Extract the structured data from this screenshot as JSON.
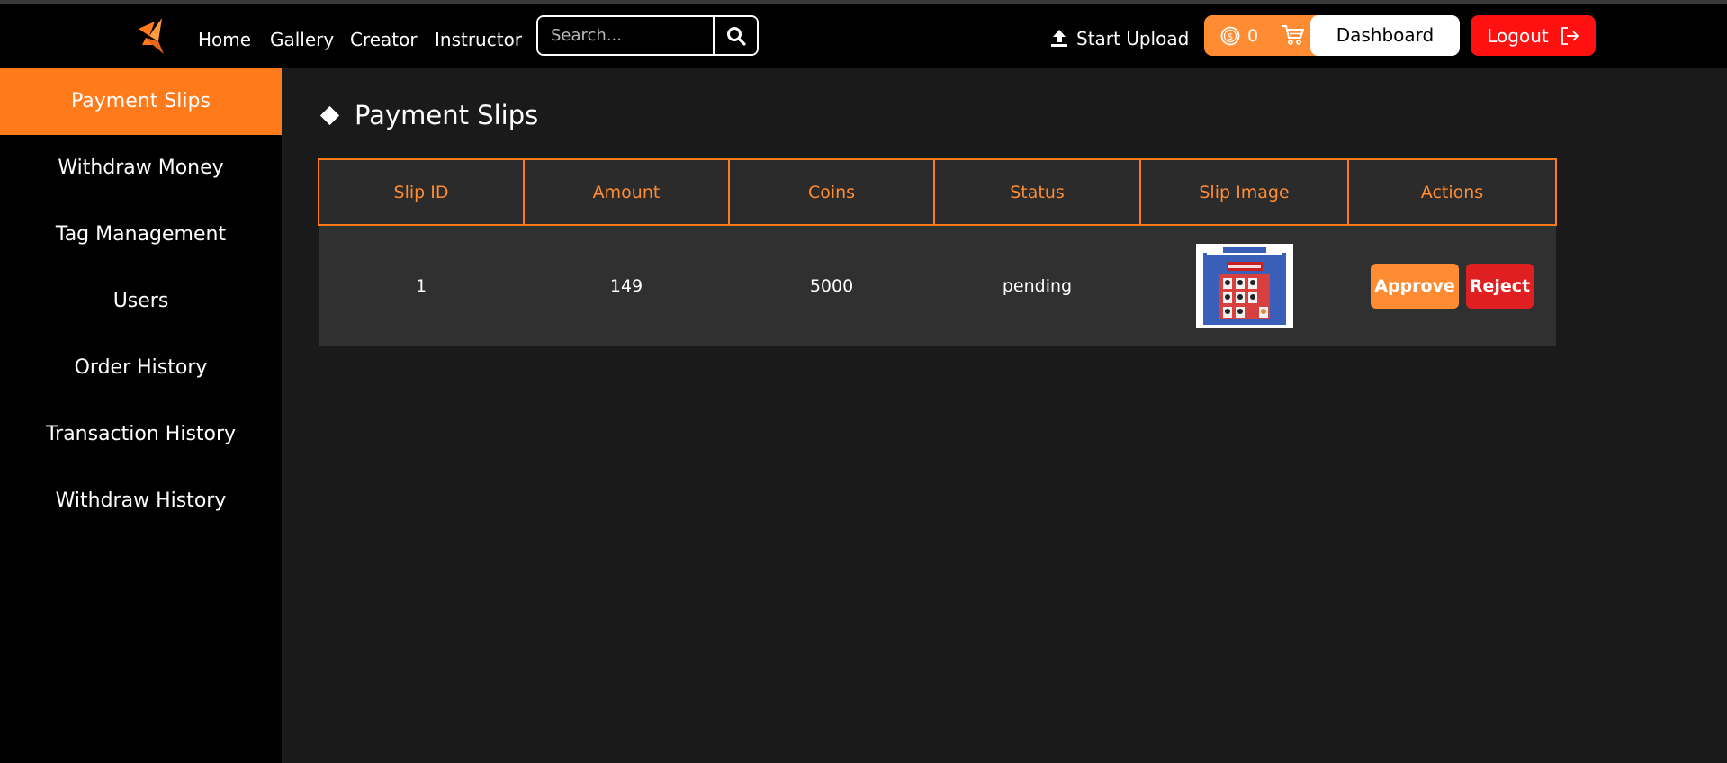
{
  "nav": {
    "logo_icon": "origami-bird-logo-icon",
    "links": [
      "Home",
      "Gallery",
      "Creator",
      "Instructor"
    ],
    "search_placeholder": "Search...",
    "search_icon": "search-icon",
    "upload_label": "Start Upload",
    "upload_icon": "upload-icon",
    "coin_count": "0",
    "coin_icon": "coin-icon",
    "cart_icon": "cart-icon",
    "dashboard_label": "Dashboard",
    "logout_label": "Logout",
    "logout_icon": "logout-icon"
  },
  "sidebar": {
    "items": [
      {
        "label": "Payment Slips",
        "active": true
      },
      {
        "label": "Withdraw Money",
        "active": false
      },
      {
        "label": "Tag Management",
        "active": false
      },
      {
        "label": "Users",
        "active": false
      },
      {
        "label": "Order History",
        "active": false
      },
      {
        "label": "Transaction History",
        "active": false
      },
      {
        "label": "Withdraw History",
        "active": false
      }
    ]
  },
  "main": {
    "title": "Payment Slips",
    "table": {
      "headers": [
        "Slip ID",
        "Amount",
        "Coins",
        "Status",
        "Slip Image",
        "Actions"
      ],
      "rows": [
        {
          "slip_id": "1",
          "amount": "149",
          "coins": "5000",
          "status": "pending",
          "approve_label": "Approve",
          "reject_label": "Reject"
        }
      ]
    }
  },
  "colors": {
    "accent": "#ff7a1a",
    "logout": "#ff1111",
    "reject": "#e02020",
    "background": "#1a1a1a",
    "sidebar": "#000000"
  }
}
